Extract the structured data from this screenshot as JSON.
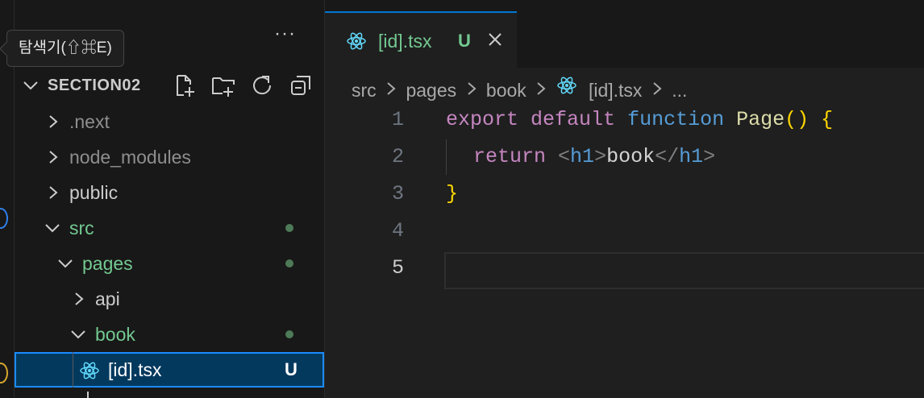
{
  "tooltip": {
    "text": "탐색기(⇧⌘E)"
  },
  "explorer": {
    "more_label": "···",
    "section_title": "SECTION02",
    "items": [
      {
        "label": ".next",
        "state": "collapsed"
      },
      {
        "label": "node_modules",
        "state": "collapsed"
      },
      {
        "label": "public",
        "state": "collapsed"
      },
      {
        "label": "src",
        "state": "expanded",
        "modified_dot": true
      },
      {
        "label": "pages",
        "state": "expanded",
        "modified_dot": true
      },
      {
        "label": "api",
        "state": "collapsed"
      },
      {
        "label": "book",
        "state": "expanded",
        "modified_dot": true
      },
      {
        "label": "[id].tsx",
        "state": "file",
        "badge": "U",
        "selected": true
      }
    ]
  },
  "editor": {
    "tab": {
      "label": "[id].tsx",
      "badge": "U"
    },
    "breadcrumb": [
      "src",
      "pages",
      "book",
      "[id].tsx",
      "..."
    ],
    "line_numbers": [
      "1",
      "2",
      "3",
      "4",
      "5"
    ],
    "code": {
      "l1_export": "export",
      "l1_default": "default",
      "l1_function": "function",
      "l1_name": "Page",
      "l1_parens": "()",
      "l1_brace": "{",
      "l2_return": "return",
      "l2_lt1": "<",
      "l2_h1a": "h1",
      "l2_gt1": ">",
      "l2_text": "book",
      "l2_lt2": "</",
      "l2_h1b": "h1",
      "l2_gt2": ">",
      "l3_brace": "}"
    }
  },
  "colors": {
    "accent": "#0078d4",
    "untracked": "#73c991",
    "keyword": "#c586c0",
    "keyword_blue": "#569cd6",
    "function": "#dcdcaa",
    "bracket": "#ffd700"
  }
}
